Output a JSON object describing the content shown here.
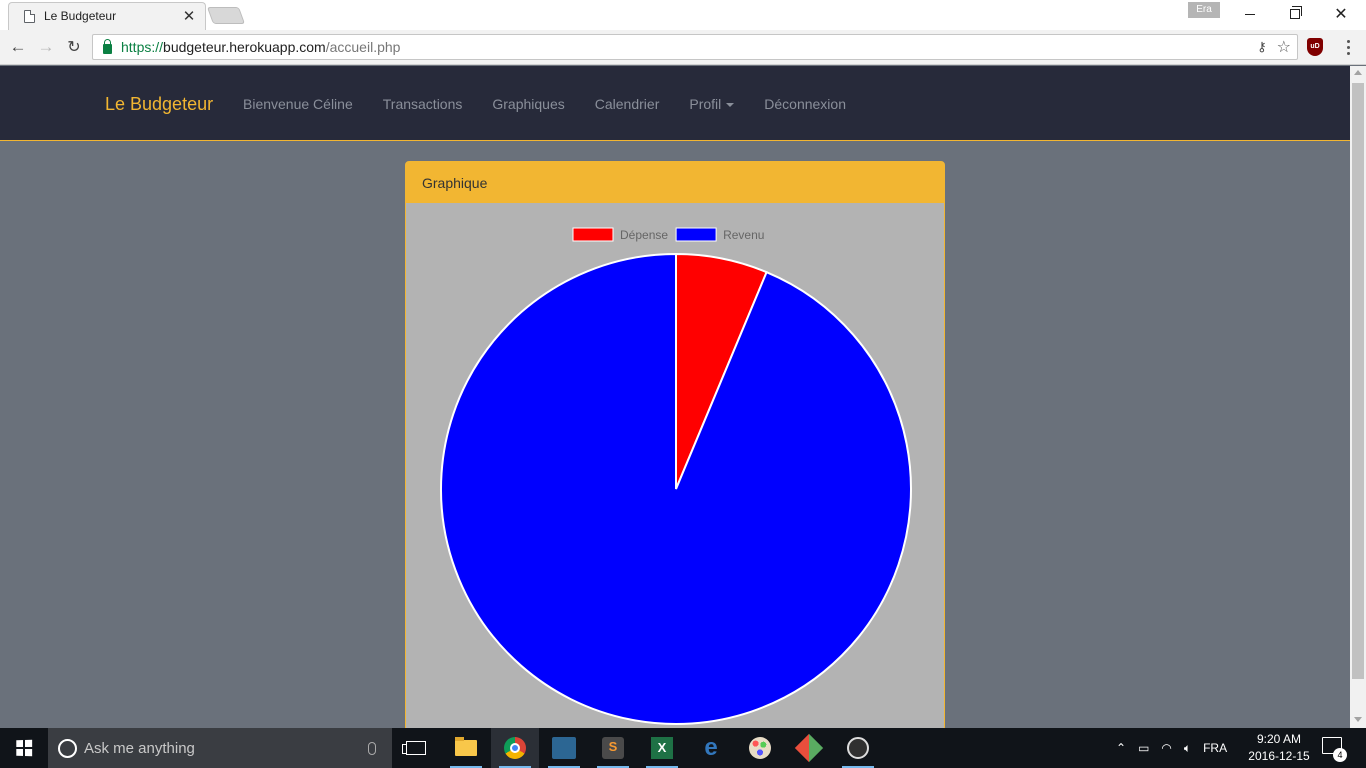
{
  "browser": {
    "tab_title": "Le Budgeteur",
    "tab_close_glyph": "✕",
    "profile_name": "Era",
    "url_scheme": "https://",
    "url_host": "budgeteur.herokuapp.com",
    "url_path": "/accueil.php",
    "ublock_label": "uD"
  },
  "navbar": {
    "brand": "Le Budgeteur",
    "links": [
      "Bienvenue Céline",
      "Transactions",
      "Graphiques",
      "Calendrier",
      "Profil",
      "Déconnexion"
    ]
  },
  "panel": {
    "title": "Graphique"
  },
  "chart_data": {
    "type": "pie",
    "categories": [
      "Dépense",
      "Revenu"
    ],
    "values": [
      6.3,
      93.7
    ],
    "colors": [
      "#ff0000",
      "#0000ff"
    ],
    "legend_position": "top",
    "value_units": "percent of total (estimated)"
  },
  "taskbar": {
    "search_placeholder": "Ask me anything",
    "language": "FRA",
    "time": "9:20 AM",
    "date": "2016-12-15",
    "notification_count": "4"
  }
}
